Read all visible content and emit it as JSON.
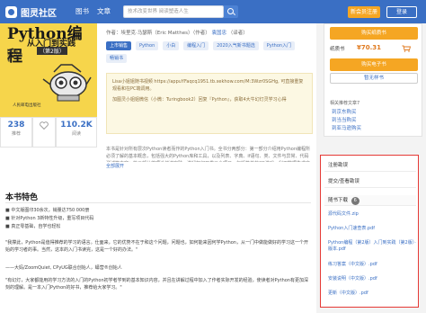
{
  "topbar": {
    "logo_text": "图灵社区",
    "nav": [
      "图书",
      "文章"
    ],
    "search_placeholder": "技术改变世界 阅读塑造人生",
    "register_label": "新会员注册",
    "login_label": "登录"
  },
  "cover": {
    "title": "Python编程",
    "subtitle": "从入门到实践",
    "edition": "（第2版）",
    "author": "[美] 埃里克·马瑟斯 著",
    "publisher": "人民邮电出版社"
  },
  "stats": [
    {
      "value": "238",
      "label": "推荐"
    },
    {
      "value": "110.2K",
      "label": "阅读"
    }
  ],
  "book": {
    "author_prefix": "作者：埃里克·马瑟斯（Eric Matthes）（作者）",
    "translator": "袁国忠",
    "translator_suffix": "（译者）",
    "tags": [
      {
        "label": "上市销售",
        "primary": true
      },
      {
        "label": "Python",
        "primary": false
      },
      {
        "label": "小白",
        "primary": false
      },
      {
        "label": "编程入门",
        "primary": false
      },
      {
        "label": "2020入气新书题选",
        "primary": false
      },
      {
        "label": "Python入门",
        "primary": false
      },
      {
        "label": "畅销书",
        "primary": false
      }
    ],
    "promo": [
      "Lisa小姐姐随书视频 https://appuYFaqcq1951.tb.xekhow.com/M:3Wzr0SGHg, 可直接重复观看和在PC端调用。",
      "加图灵小姐姐微信（小微：Turingbook2）回复『Python』，获取4大牛幻灯灵学习心得"
    ],
    "description": "本书是针对所有层次Python读者而作的Python入门书。全书分两部分：第一部分介绍用Python编程所必须了解的基本概念，包括强大的Python库和工具，以及列表、字典、if语句、类、文件与异常、代码测试等内容；第二部分将理论付诸实践，讲解如何开发三个项目，包括简单的2D游戏、利用数据生成交互式的信息图以及创建和定制简单的Web应用。",
    "expand_label": "全部展开"
  },
  "features": {
    "title": "本书特色",
    "items": [
      "■ 中文版图印30余次，销量达750 000册",
      "■ 针对Python 3新特性升级，重写项目代码",
      "■ 真正零基础，自学也轻松"
    ],
    "quote1": "\"我撑此，Python是值得推荐的学习的语言。仕面来，它的优势不在于和这个问题，问题也，如何能来因何学Python，从一门中做能做好的学习这一个开始的学习者的事。当然，这本的入门书读完，这是一个好的办法。\"",
    "quote1_by": "——大妈/ZoomQuiet, CPyUG联合创始人，蟒营®创始人",
    "quote2": "\"有幻灯，大家都能用的学习方法的入门的Python初学者学到的基本知识内容，并且在讲解过程中加入了作者实际开发的经验，使读者对Python有更加深刻的理解。是一本入门Python的好书，推荐给大家学习。\""
  },
  "side": {
    "buy_paper_label": "购买纸质书",
    "price_label": "纸质书",
    "price": "¥70.31",
    "buy_ebook_label": "购买电子书",
    "sample_label": "暂无样书",
    "related_title": "相关推荐文章7",
    "related": [
      "到京东购买",
      "到当当购买",
      "到亚马逊购买"
    ]
  },
  "panel": {
    "errata_label": "注册勘误",
    "submit_label": "提交/查看勘误",
    "download_label": "随书下载",
    "download_count": "6",
    "downloads": [
      "源代码文件.zip",
      "Python入门速查表.pdf",
      "Python编程（第2版）入门到实践（第2版）· 版本.pdf",
      "练习答案（中文版）.pdf",
      "安装说明（中文版）.pdf",
      "更新（中文版）.pdf"
    ]
  }
}
